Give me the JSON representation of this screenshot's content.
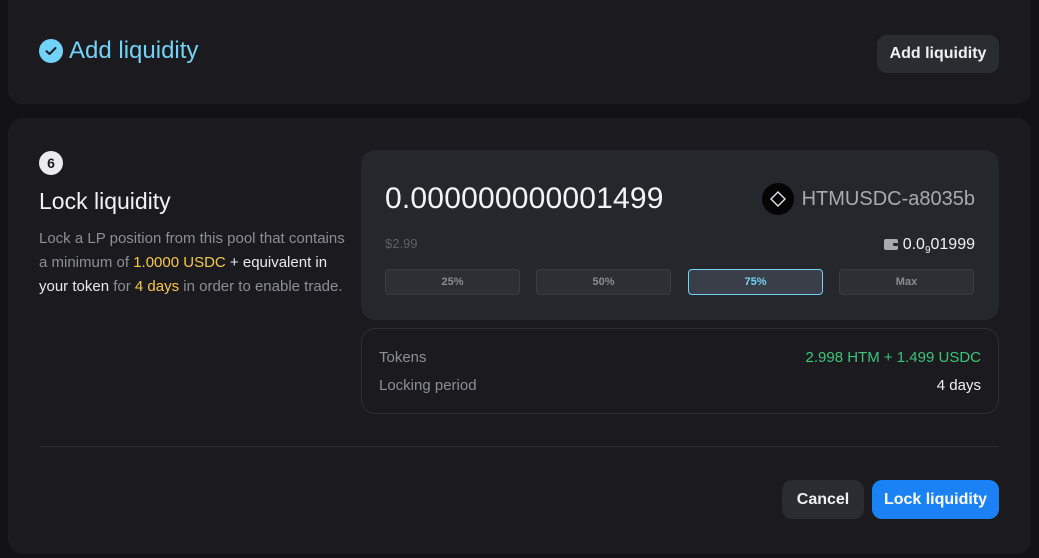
{
  "header": {
    "title": "Add liquidity",
    "button_label": "Add liquidity"
  },
  "lock": {
    "step_number": "6",
    "title": "Lock liquidity",
    "desc_part1": "Lock a LP position from this pool that contains a minimum of ",
    "min_amount": "1.0000 USDC",
    "desc_part2": " + equivalent in your token",
    "desc_part3": " for ",
    "period": "4 days",
    "desc_part4": " in order to enable trade."
  },
  "input": {
    "amount": "0.000000000001499",
    "token_name": "HTMUSDC-a8035b",
    "usd_value": "$2.99",
    "balance_main": "0.0",
    "balance_sub": "9",
    "balance_rest": "01999",
    "percent_buttons": [
      "25%",
      "50%",
      "75%",
      "Max"
    ],
    "active_percent": "75%"
  },
  "info": {
    "tokens_label": "Tokens",
    "tokens_value": "2.998 HTM + 1.499 USDC",
    "period_label": "Locking period",
    "period_value": "4 days"
  },
  "actions": {
    "cancel_label": "Cancel",
    "lock_label": "Lock liquidity"
  },
  "colors": {
    "accent": "#72d2f7",
    "primary_button": "#1a82f5",
    "highlight": "#f7c94b",
    "positive": "#3cc47a"
  },
  "icons": {
    "header": "check-circle-icon",
    "token": "diamond-icon",
    "balance": "wallet-icon"
  }
}
